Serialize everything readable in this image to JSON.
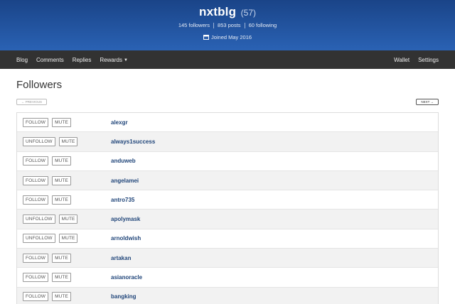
{
  "profile": {
    "username": "nxtblg",
    "reputation": "(57)",
    "followers": "145 followers",
    "posts": "853 posts",
    "following": "60 following",
    "joined": "Joined May 2016"
  },
  "nav": {
    "left": [
      "Blog",
      "Comments",
      "Replies",
      "Rewards"
    ],
    "right": [
      "Wallet",
      "Settings"
    ]
  },
  "page": {
    "title": "Followers",
    "prev_label": "← PREVIOUS",
    "next_label": "NEXT →"
  },
  "followers": [
    {
      "action": "FOLLOW",
      "mute": "MUTE",
      "name": "alexgr"
    },
    {
      "action": "UNFOLLOW",
      "mute": "MUTE",
      "name": "always1success"
    },
    {
      "action": "FOLLOW",
      "mute": "MUTE",
      "name": "anduweb"
    },
    {
      "action": "FOLLOW",
      "mute": "MUTE",
      "name": "angelamei"
    },
    {
      "action": "FOLLOW",
      "mute": "MUTE",
      "name": "antro735"
    },
    {
      "action": "UNFOLLOW",
      "mute": "MUTE",
      "name": "apolymask"
    },
    {
      "action": "UNFOLLOW",
      "mute": "MUTE",
      "name": "arnoldwish"
    },
    {
      "action": "FOLLOW",
      "mute": "MUTE",
      "name": "artakan"
    },
    {
      "action": "FOLLOW",
      "mute": "MUTE",
      "name": "asianoracle"
    },
    {
      "action": "FOLLOW",
      "mute": "MUTE",
      "name": "bangking"
    }
  ],
  "colors": {
    "hero": "#2a62b4",
    "navbar": "#323232",
    "link": "#21467a"
  },
  "icons": {
    "joined": "calendar-icon",
    "rewards_caret": "chevron-down-icon"
  }
}
